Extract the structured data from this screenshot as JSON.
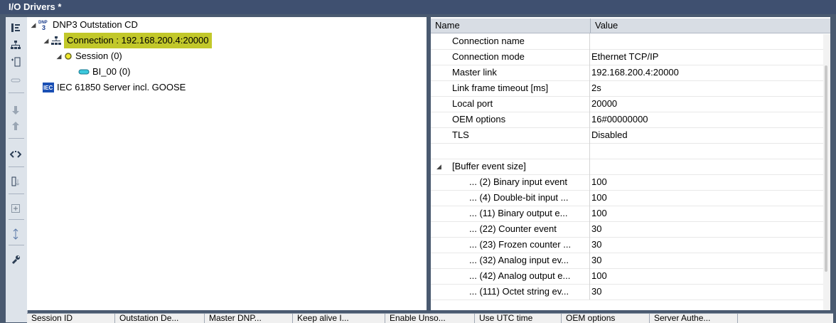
{
  "window": {
    "title": "I/O Drivers *"
  },
  "tree": {
    "items": [
      {
        "label": "DNP3 Outstation CD",
        "icon": "dnp3-icon",
        "expanded": true
      },
      {
        "label": "Connection : 192.168.200.4:20000",
        "icon": "network-icon",
        "expanded": true,
        "selected": true
      },
      {
        "label": "Session (0)",
        "icon": "session-circle-icon",
        "expanded": true
      },
      {
        "label": "BI_00 (0)",
        "icon": "data-point-icon"
      },
      {
        "label": "IEC 61850 Server incl. GOOSE",
        "icon": "iec-icon"
      }
    ]
  },
  "properties": {
    "header": {
      "name": "Name",
      "value": "Value"
    },
    "rows": [
      {
        "name": "Connection name",
        "value": ""
      },
      {
        "name": "Connection mode",
        "value": "Ethernet TCP/IP"
      },
      {
        "name": "Master link",
        "value": "192.168.200.4:20000"
      },
      {
        "name": "Link frame timeout [ms]",
        "value": "2s"
      },
      {
        "name": "Local port",
        "value": "20000"
      },
      {
        "name": "OEM options",
        "value": "16#00000000"
      },
      {
        "name": "TLS",
        "value": "Disabled"
      },
      {
        "name": "",
        "value": ""
      },
      {
        "name": "[Buffer event size]",
        "value": ""
      },
      {
        "name": "... (2) Binary input event",
        "value": "100"
      },
      {
        "name": "... (4) Double-bit input ...",
        "value": "100"
      },
      {
        "name": "... (11) Binary output e...",
        "value": "100"
      },
      {
        "name": "... (22) Counter event",
        "value": "30"
      },
      {
        "name": "... (23) Frozen counter ...",
        "value": "30"
      },
      {
        "name": "... (32) Analog input ev...",
        "value": "30"
      },
      {
        "name": "... (42) Analog output e...",
        "value": "100"
      },
      {
        "name": "... (111) Octet string ev...",
        "value": "30"
      }
    ]
  },
  "bottom_columns": [
    "Session ID",
    "Outstation De...",
    "Master DNP...",
    "Keep alive I...",
    "Enable Unso...",
    "Use UTC time",
    "OEM options",
    "Server Authe..."
  ],
  "toolbar": [
    "align-left-icon",
    "network-icon",
    "insert-icon",
    "link-icon",
    "move-down-icon",
    "move-up-icon",
    "code-icon",
    "sort-icon",
    "add-icon",
    "scroll-icon",
    "wrench-icon"
  ],
  "colors": {
    "selection": "#c2c82a",
    "titlebar": "#3f5070"
  }
}
